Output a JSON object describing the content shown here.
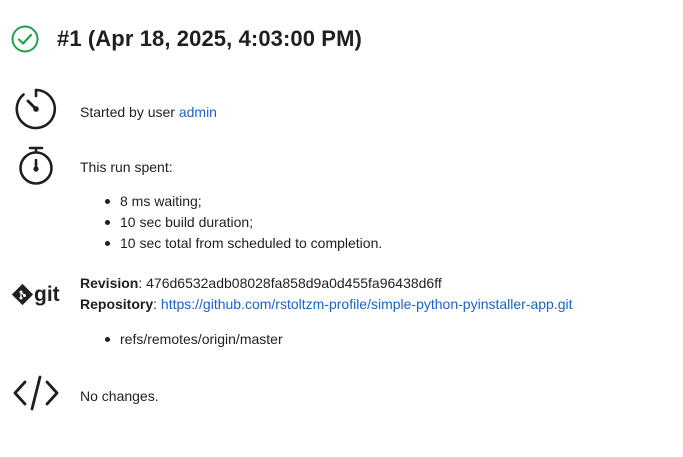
{
  "header": {
    "title": "#1 (Apr 18, 2025, 4:03:00 PM)",
    "status_icon": "success-check-circle-icon",
    "status_color": "#1ea446"
  },
  "cause": {
    "icon": "timer-gauge-icon",
    "prefix": "Started by user ",
    "user_link": "admin"
  },
  "timing": {
    "icon": "stopwatch-icon",
    "heading": "This run spent:",
    "items": [
      "8 ms waiting;",
      "10 sec build duration;",
      "10 sec total from scheduled to completion."
    ]
  },
  "git": {
    "icon": "git-logo-icon",
    "logo_text": "git",
    "revision_label": "Revision",
    "revision_value": ": 476d6532adb08028fa858d9a0d455fa96438d6ff",
    "repository_label": "Repository",
    "repository_sep": ": ",
    "repository_url": "https://github.com/rstoltzm-profile/simple-python-pyinstaller-app.git",
    "branches": [
      "refs/remotes/origin/master"
    ]
  },
  "changes": {
    "icon": "code-brackets-icon",
    "text": "No changes."
  },
  "colors": {
    "link": "#1b63c7",
    "text": "#1f1f1f"
  }
}
